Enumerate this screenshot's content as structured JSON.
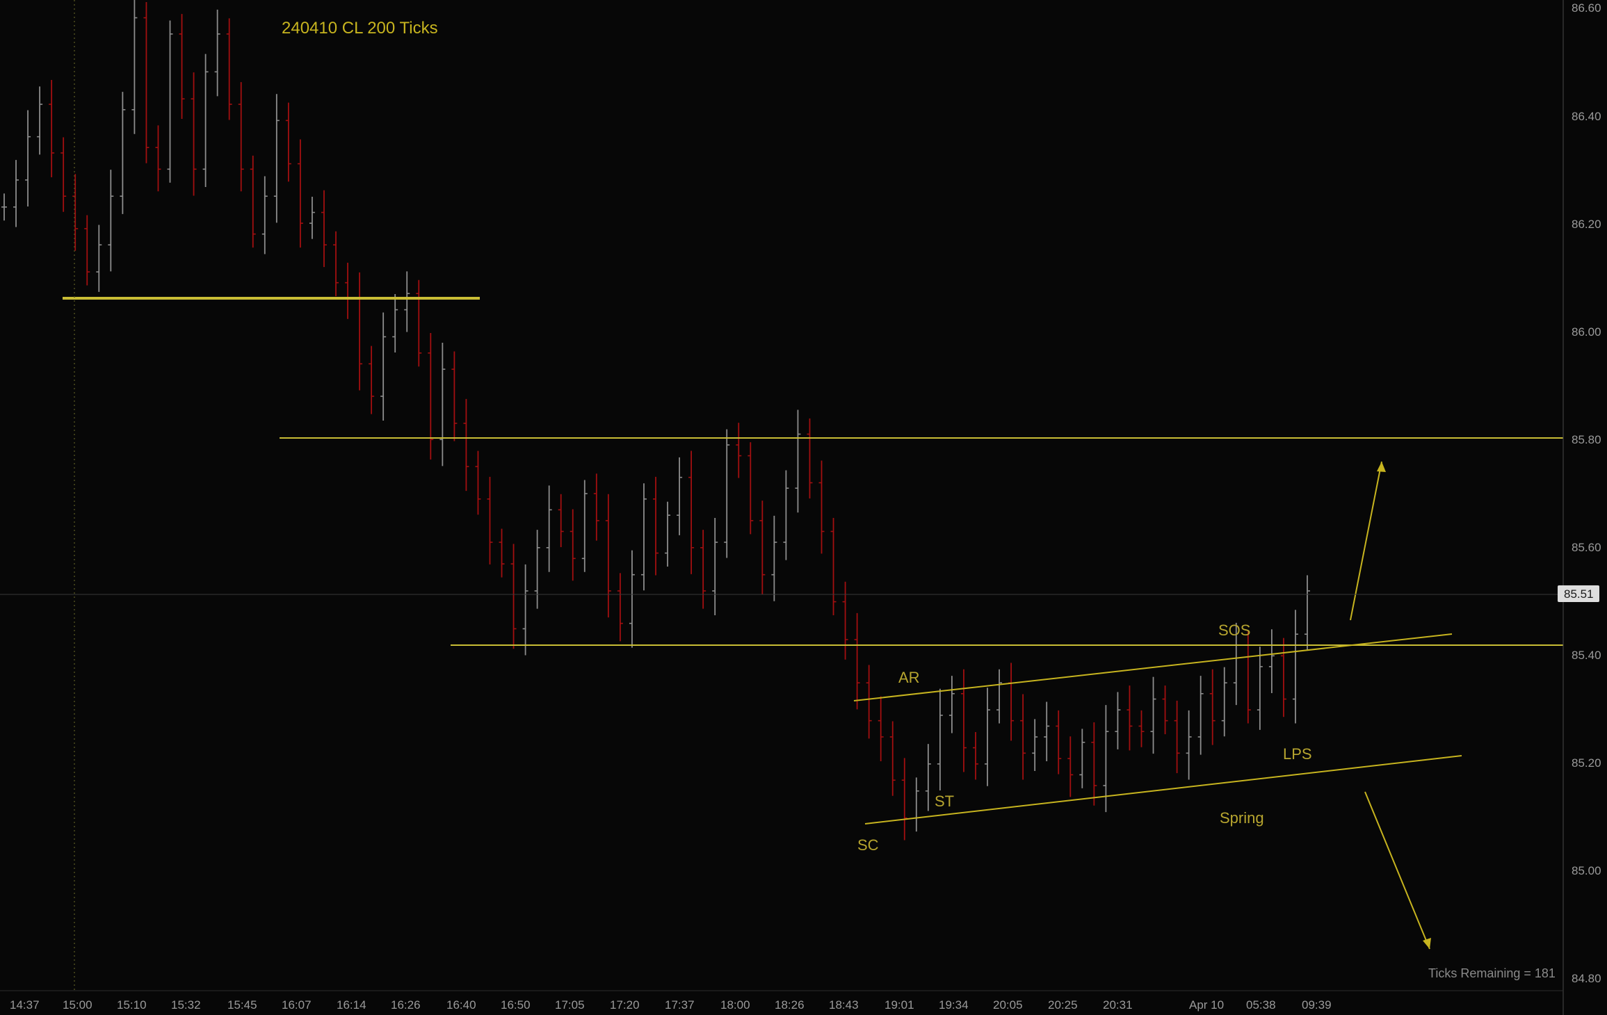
{
  "chart_data": {
    "type": "ohlc",
    "title": "240410 CL 200 Ticks",
    "current_price": "85.51",
    "ticks_remaining": "Ticks Remaining = 181",
    "ylim": [
      84.8,
      86.6
    ],
    "y_ticks": [
      "86.60",
      "86.40",
      "86.20",
      "86.00",
      "85.80",
      "85.60",
      "85.40",
      "85.20",
      "85.00",
      "84.80"
    ],
    "x_ticks": [
      "14:37",
      "15:00",
      "15:10",
      "15:32",
      "15:45",
      "16:07",
      "16:14",
      "16:26",
      "16:40",
      "16:50",
      "17:05",
      "17:20",
      "17:37",
      "18:00",
      "18:26",
      "18:43",
      "19:01",
      "19:34",
      "20:05",
      "20:25",
      "20:31",
      "Apr 10",
      "05:38",
      "09:39"
    ],
    "series": [
      {
        "values": [
          86.23,
          86.28,
          86.36,
          86.42,
          86.33,
          86.25,
          86.19,
          86.11,
          86.16,
          86.25,
          86.41,
          86.58,
          86.34,
          86.3,
          86.55,
          86.43,
          86.3,
          86.48,
          86.55,
          86.42,
          86.3,
          86.18,
          86.25,
          86.39,
          86.31,
          86.2,
          86.22,
          86.16,
          86.09,
          86.06,
          85.94,
          85.88,
          85.99,
          86.04,
          86.07,
          85.96,
          85.8,
          85.93,
          85.83,
          85.75,
          85.69,
          85.61,
          85.57,
          85.45,
          85.52,
          85.6,
          85.67,
          85.63,
          85.58,
          85.7,
          85.65,
          85.52,
          85.46,
          85.55,
          85.69,
          85.59,
          85.66,
          85.73,
          85.6,
          85.52,
          85.61,
          85.79,
          85.77,
          85.65,
          85.55,
          85.61,
          85.71,
          85.81,
          85.72,
          85.63,
          85.5,
          85.43,
          85.35,
          85.28,
          85.25,
          85.17,
          85.1,
          85.15,
          85.2,
          85.29,
          85.33,
          85.23,
          85.2,
          85.3,
          85.35,
          85.28,
          85.22,
          85.25,
          85.27,
          85.21,
          85.18,
          85.24,
          85.16,
          85.26,
          85.3,
          85.27,
          85.26,
          85.32,
          85.28,
          85.22,
          85.25,
          85.33,
          85.28,
          85.35,
          85.42,
          85.3,
          85.38,
          85.4,
          85.32,
          85.44,
          85.52
        ]
      }
    ],
    "levels": [
      "86.06",
      "85.81",
      "85.43"
    ],
    "annotations": [
      "SC",
      "AR",
      "ST",
      "SOS",
      "Spring",
      "LPS"
    ],
    "colors": {
      "background": "#070707",
      "up_bar": "#8d8d8d",
      "down_bar": "#a20f10",
      "annotation": "#b7a52f",
      "level": "#c9bd35",
      "axis_text": "#9a9a9a",
      "grid": "#2a2a2a"
    }
  }
}
